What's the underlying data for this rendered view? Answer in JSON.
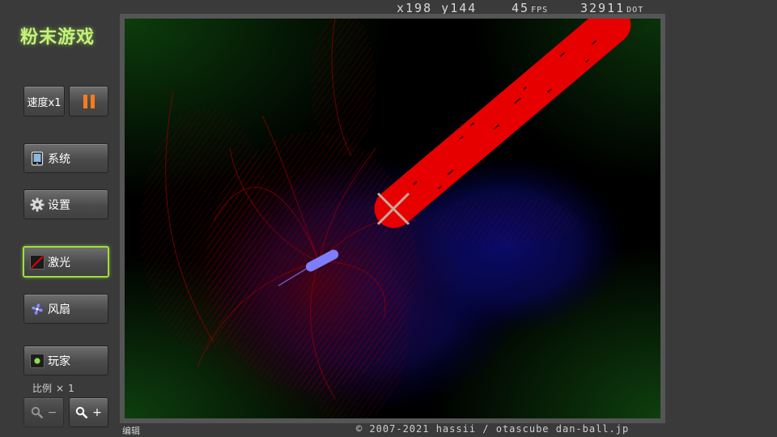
{
  "app": {
    "title": "粉末游戏"
  },
  "hud": {
    "x_label": "x",
    "x_value": "198",
    "y_label": "y",
    "y_value": "144",
    "fps_value": "45",
    "fps_unit": "FPS",
    "dot_value": "32911",
    "dot_unit": "DOT"
  },
  "sidebar": {
    "speed_label": "速度x1",
    "system_label": "系统",
    "settings_label": "设置",
    "tools": [
      {
        "label": "激光",
        "icon": "laser-icon",
        "selected": true
      },
      {
        "label": "风扇",
        "icon": "fan-icon",
        "selected": false
      },
      {
        "label": "玩家",
        "icon": "player-icon",
        "selected": false
      }
    ],
    "scale_label": "比例",
    "scale_x": "×",
    "scale_value": "1",
    "zoom_out_label": "−",
    "zoom_in_label": "+"
  },
  "footer": {
    "edit_label": "编辑",
    "copyright": "© 2007-2021 hassii / otascube  dan-ball.jp"
  },
  "colors": {
    "accent_green": "#9be03c",
    "title_green": "#c6f27a",
    "pause_orange": "#ff7a1a",
    "laser_red": "#e60000",
    "fan_blue": "#7d7dff"
  }
}
